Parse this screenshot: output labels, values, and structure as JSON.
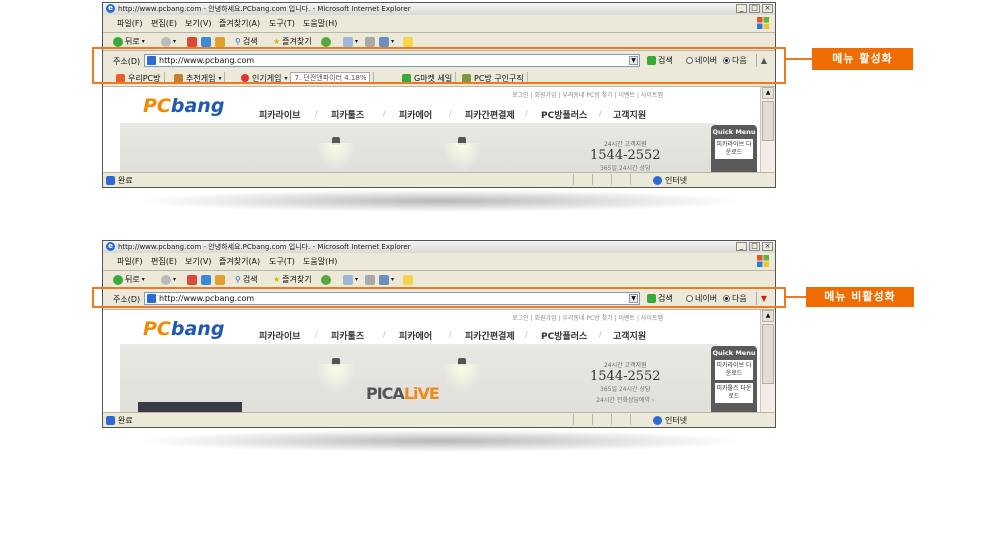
{
  "window": {
    "title": "http://www.pcbang.com - 안녕하세요.PCbang.com 입니다. - Microsoft Internet Explorer",
    "controls": [
      "_",
      "□",
      "×"
    ]
  },
  "menu": [
    "파일(F)",
    "편집(E)",
    "보기(V)",
    "즐겨찾기(A)",
    "도구(T)",
    "도움말(H)"
  ],
  "toolbar": {
    "back": "뒤로",
    "search": "검색",
    "favorites": "즐겨찾기"
  },
  "address": {
    "label": "주소(D)",
    "url": "http://www.pcbang.com",
    "go": "검색",
    "options": [
      "네이버",
      "다음"
    ],
    "selected": "다음"
  },
  "links": {
    "items": [
      "우리PC방",
      "추천게임",
      "인기게임",
      "G마켓 세일",
      "PC방 구인구직"
    ],
    "ticker": "7. 던전앤파이터 4.18%"
  },
  "site": {
    "util": "로그인 | 회원가입 | 우리동네 PC방 찾기 | 이벤트 | 사이트맵",
    "logo_a": "PC",
    "logo_b": "bang",
    "nav": [
      "피카라이브",
      "피카툴즈",
      "피카에어",
      "피카간편결제",
      "PC방플러스",
      "고객지원"
    ],
    "support": {
      "caption": "24시간 고객지원",
      "tel": "1544-2552",
      "hours": "365일 24시간 상담",
      "extra": "24시간 전화상담예약 ›"
    },
    "quick_menu": {
      "title": "Quick Menu",
      "items": [
        "피카라이브 다운로드",
        "피카툴즈 다운로드"
      ]
    },
    "picalive_a": "PICA",
    "picalive_b": "LiVE"
  },
  "status": {
    "done": "완료",
    "zone": "인터넷"
  },
  "callouts": {
    "active": "메뉴 활성화",
    "inactive": "메뉴 비활성화"
  },
  "colors": {
    "highlight": "#f07820",
    "callout_bg": "#ef6c00"
  }
}
